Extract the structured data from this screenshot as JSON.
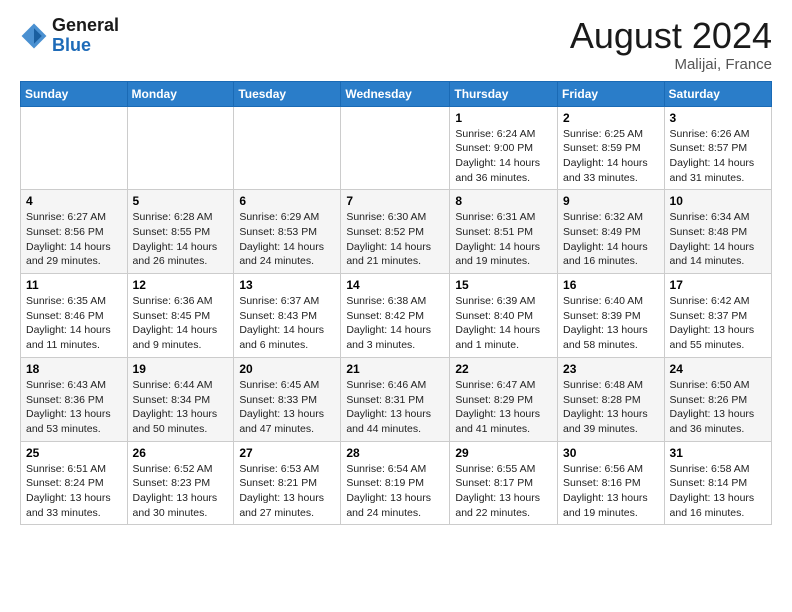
{
  "header": {
    "logo": {
      "general": "General",
      "blue": "Blue"
    },
    "title": "August 2024",
    "location": "Malijai, France"
  },
  "weekdays": [
    "Sunday",
    "Monday",
    "Tuesday",
    "Wednesday",
    "Thursday",
    "Friday",
    "Saturday"
  ],
  "weeks": [
    [
      {
        "day": "",
        "info": ""
      },
      {
        "day": "",
        "info": ""
      },
      {
        "day": "",
        "info": ""
      },
      {
        "day": "",
        "info": ""
      },
      {
        "day": "1",
        "info": "Sunrise: 6:24 AM\nSunset: 9:00 PM\nDaylight: 14 hours\nand 36 minutes."
      },
      {
        "day": "2",
        "info": "Sunrise: 6:25 AM\nSunset: 8:59 PM\nDaylight: 14 hours\nand 33 minutes."
      },
      {
        "day": "3",
        "info": "Sunrise: 6:26 AM\nSunset: 8:57 PM\nDaylight: 14 hours\nand 31 minutes."
      }
    ],
    [
      {
        "day": "4",
        "info": "Sunrise: 6:27 AM\nSunset: 8:56 PM\nDaylight: 14 hours\nand 29 minutes."
      },
      {
        "day": "5",
        "info": "Sunrise: 6:28 AM\nSunset: 8:55 PM\nDaylight: 14 hours\nand 26 minutes."
      },
      {
        "day": "6",
        "info": "Sunrise: 6:29 AM\nSunset: 8:53 PM\nDaylight: 14 hours\nand 24 minutes."
      },
      {
        "day": "7",
        "info": "Sunrise: 6:30 AM\nSunset: 8:52 PM\nDaylight: 14 hours\nand 21 minutes."
      },
      {
        "day": "8",
        "info": "Sunrise: 6:31 AM\nSunset: 8:51 PM\nDaylight: 14 hours\nand 19 minutes."
      },
      {
        "day": "9",
        "info": "Sunrise: 6:32 AM\nSunset: 8:49 PM\nDaylight: 14 hours\nand 16 minutes."
      },
      {
        "day": "10",
        "info": "Sunrise: 6:34 AM\nSunset: 8:48 PM\nDaylight: 14 hours\nand 14 minutes."
      }
    ],
    [
      {
        "day": "11",
        "info": "Sunrise: 6:35 AM\nSunset: 8:46 PM\nDaylight: 14 hours\nand 11 minutes."
      },
      {
        "day": "12",
        "info": "Sunrise: 6:36 AM\nSunset: 8:45 PM\nDaylight: 14 hours\nand 9 minutes."
      },
      {
        "day": "13",
        "info": "Sunrise: 6:37 AM\nSunset: 8:43 PM\nDaylight: 14 hours\nand 6 minutes."
      },
      {
        "day": "14",
        "info": "Sunrise: 6:38 AM\nSunset: 8:42 PM\nDaylight: 14 hours\nand 3 minutes."
      },
      {
        "day": "15",
        "info": "Sunrise: 6:39 AM\nSunset: 8:40 PM\nDaylight: 14 hours\nand 1 minute."
      },
      {
        "day": "16",
        "info": "Sunrise: 6:40 AM\nSunset: 8:39 PM\nDaylight: 13 hours\nand 58 minutes."
      },
      {
        "day": "17",
        "info": "Sunrise: 6:42 AM\nSunset: 8:37 PM\nDaylight: 13 hours\nand 55 minutes."
      }
    ],
    [
      {
        "day": "18",
        "info": "Sunrise: 6:43 AM\nSunset: 8:36 PM\nDaylight: 13 hours\nand 53 minutes."
      },
      {
        "day": "19",
        "info": "Sunrise: 6:44 AM\nSunset: 8:34 PM\nDaylight: 13 hours\nand 50 minutes."
      },
      {
        "day": "20",
        "info": "Sunrise: 6:45 AM\nSunset: 8:33 PM\nDaylight: 13 hours\nand 47 minutes."
      },
      {
        "day": "21",
        "info": "Sunrise: 6:46 AM\nSunset: 8:31 PM\nDaylight: 13 hours\nand 44 minutes."
      },
      {
        "day": "22",
        "info": "Sunrise: 6:47 AM\nSunset: 8:29 PM\nDaylight: 13 hours\nand 41 minutes."
      },
      {
        "day": "23",
        "info": "Sunrise: 6:48 AM\nSunset: 8:28 PM\nDaylight: 13 hours\nand 39 minutes."
      },
      {
        "day": "24",
        "info": "Sunrise: 6:50 AM\nSunset: 8:26 PM\nDaylight: 13 hours\nand 36 minutes."
      }
    ],
    [
      {
        "day": "25",
        "info": "Sunrise: 6:51 AM\nSunset: 8:24 PM\nDaylight: 13 hours\nand 33 minutes."
      },
      {
        "day": "26",
        "info": "Sunrise: 6:52 AM\nSunset: 8:23 PM\nDaylight: 13 hours\nand 30 minutes."
      },
      {
        "day": "27",
        "info": "Sunrise: 6:53 AM\nSunset: 8:21 PM\nDaylight: 13 hours\nand 27 minutes."
      },
      {
        "day": "28",
        "info": "Sunrise: 6:54 AM\nSunset: 8:19 PM\nDaylight: 13 hours\nand 24 minutes."
      },
      {
        "day": "29",
        "info": "Sunrise: 6:55 AM\nSunset: 8:17 PM\nDaylight: 13 hours\nand 22 minutes."
      },
      {
        "day": "30",
        "info": "Sunrise: 6:56 AM\nSunset: 8:16 PM\nDaylight: 13 hours\nand 19 minutes."
      },
      {
        "day": "31",
        "info": "Sunrise: 6:58 AM\nSunset: 8:14 PM\nDaylight: 13 hours\nand 16 minutes."
      }
    ]
  ]
}
